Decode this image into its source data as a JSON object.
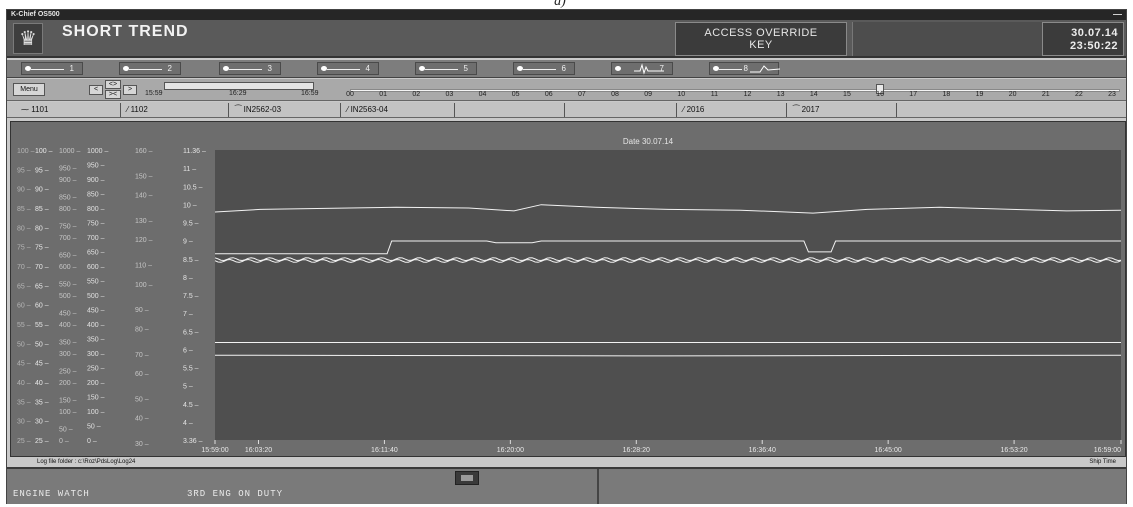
{
  "caption": "a)",
  "window": {
    "title": "K-Chief OS500",
    "minimize_glyph": "—"
  },
  "header": {
    "logo_icon": "crest-icon",
    "title": "SHORT TREND",
    "access_line1": "ACCESS OVERRIDE",
    "access_line2": "KEY",
    "date": "30.07.14",
    "time": "23:50:22"
  },
  "groups": [
    {
      "label": "1"
    },
    {
      "label": "2"
    },
    {
      "label": "3"
    },
    {
      "label": "4"
    },
    {
      "label": "5"
    },
    {
      "label": "6"
    },
    {
      "label": "7"
    },
    {
      "label": "8"
    }
  ],
  "timenav": {
    "menu_label": "Menu",
    "prev_label": "<",
    "zoom_in_label": "<>",
    "zoom_out_label": "><",
    "next_label": ">",
    "range_start": "15:59",
    "range_mid": "16:29",
    "range_end": "16:59",
    "hours": [
      "00",
      "01",
      "02",
      "03",
      "04",
      "05",
      "06",
      "07",
      "08",
      "09",
      "10",
      "11",
      "12",
      "13",
      "14",
      "15",
      "16",
      "17",
      "18",
      "19",
      "20",
      "21",
      "22",
      "23"
    ],
    "hour_position": 16
  },
  "legend": [
    "1101",
    "1102",
    "IN2562-03",
    "IN2563-04",
    "",
    "",
    "2016",
    "2017"
  ],
  "chart_data": {
    "type": "line",
    "title": "Date 30.07.14",
    "x_ticks": [
      "15:59:00",
      "16:03:20",
      "16:11:40",
      "16:20:00",
      "16:28:20",
      "16:36:40",
      "16:45:00",
      "16:53:20",
      "16:59:00"
    ],
    "axes": [
      {
        "ticks": [
          "100",
          "95",
          "90",
          "85",
          "80",
          "75",
          "70",
          "65",
          "60",
          "55",
          "50",
          "45",
          "40",
          "35",
          "30",
          "25"
        ]
      },
      {
        "ticks": [
          "100",
          "95",
          "90",
          "85",
          "80",
          "75",
          "70",
          "65",
          "60",
          "55",
          "50",
          "45",
          "40",
          "35",
          "30",
          "25"
        ]
      },
      {
        "ticks": [
          "1000",
          "950",
          "900",
          "850",
          "800",
          "750",
          "700",
          "650",
          "600",
          "550",
          "500",
          "450",
          "400",
          "350",
          "300",
          "250",
          "200",
          "150",
          "100",
          "50",
          "0"
        ]
      },
      {
        "ticks": [
          "1000",
          "950",
          "900",
          "850",
          "800",
          "750",
          "700",
          "650",
          "600",
          "550",
          "500",
          "450",
          "400",
          "350",
          "300",
          "250",
          "200",
          "150",
          "100",
          "50",
          "0"
        ]
      },
      {
        "ticks": [
          "160",
          "150",
          "140",
          "130",
          "120",
          "110",
          "100",
          "90",
          "80",
          "70",
          "60",
          "50",
          "40",
          "30"
        ]
      },
      {
        "ticks": [
          "11.36",
          "11",
          "10.5",
          "10",
          "9.5",
          "9",
          "8.5",
          "8",
          "7.5",
          "7",
          "6.5",
          "6",
          "5.5",
          "5",
          "4.5",
          "4",
          "3.36"
        ]
      }
    ],
    "series_right_axis": [
      {
        "x": [
          0,
          0.05,
          0.2,
          0.28,
          0.33,
          0.36,
          0.42,
          0.5,
          0.58,
          0.66,
          0.72,
          0.8,
          0.88,
          0.94,
          1.0
        ],
        "y": [
          9.65,
          9.72,
          9.78,
          9.76,
          9.68,
          9.85,
          9.78,
          9.72,
          9.7,
          9.62,
          9.72,
          9.78,
          9.72,
          9.68,
          9.7
        ]
      },
      {
        "x": [
          0,
          0.19,
          0.195,
          0.3,
          0.31,
          0.35,
          0.36,
          0.65,
          0.655,
          0.68,
          0.685,
          1.0
        ],
        "y": [
          8.5,
          8.5,
          8.85,
          8.85,
          8.8,
          8.8,
          8.85,
          8.85,
          8.55,
          8.55,
          8.85,
          8.85
        ]
      },
      {
        "x": [
          0,
          1.0
        ],
        "y": [
          8.35,
          8.35
        ]
      },
      {
        "x": [
          0,
          1.0
        ],
        "y": [
          8.3,
          8.3
        ]
      },
      {
        "x": [
          0,
          1.0
        ],
        "y": [
          6.05,
          6.05
        ]
      },
      {
        "x": [
          0,
          0.5,
          1.0
        ],
        "y": [
          5.7,
          5.68,
          5.7
        ]
      }
    ],
    "colors": {
      "plot_bg": "#4f4f4f",
      "line": "#f2f2f2",
      "grid": "#5c5c5c"
    }
  },
  "footer": {
    "log_folder": "Log file folder : c:\\Roz\\PdsLog\\Log24",
    "ship_time": "Ship Time"
  },
  "status": {
    "watch": "ENGINE WATCH",
    "duty": "3RD ENG ON DUTY",
    "icon": "monitor-icon"
  }
}
